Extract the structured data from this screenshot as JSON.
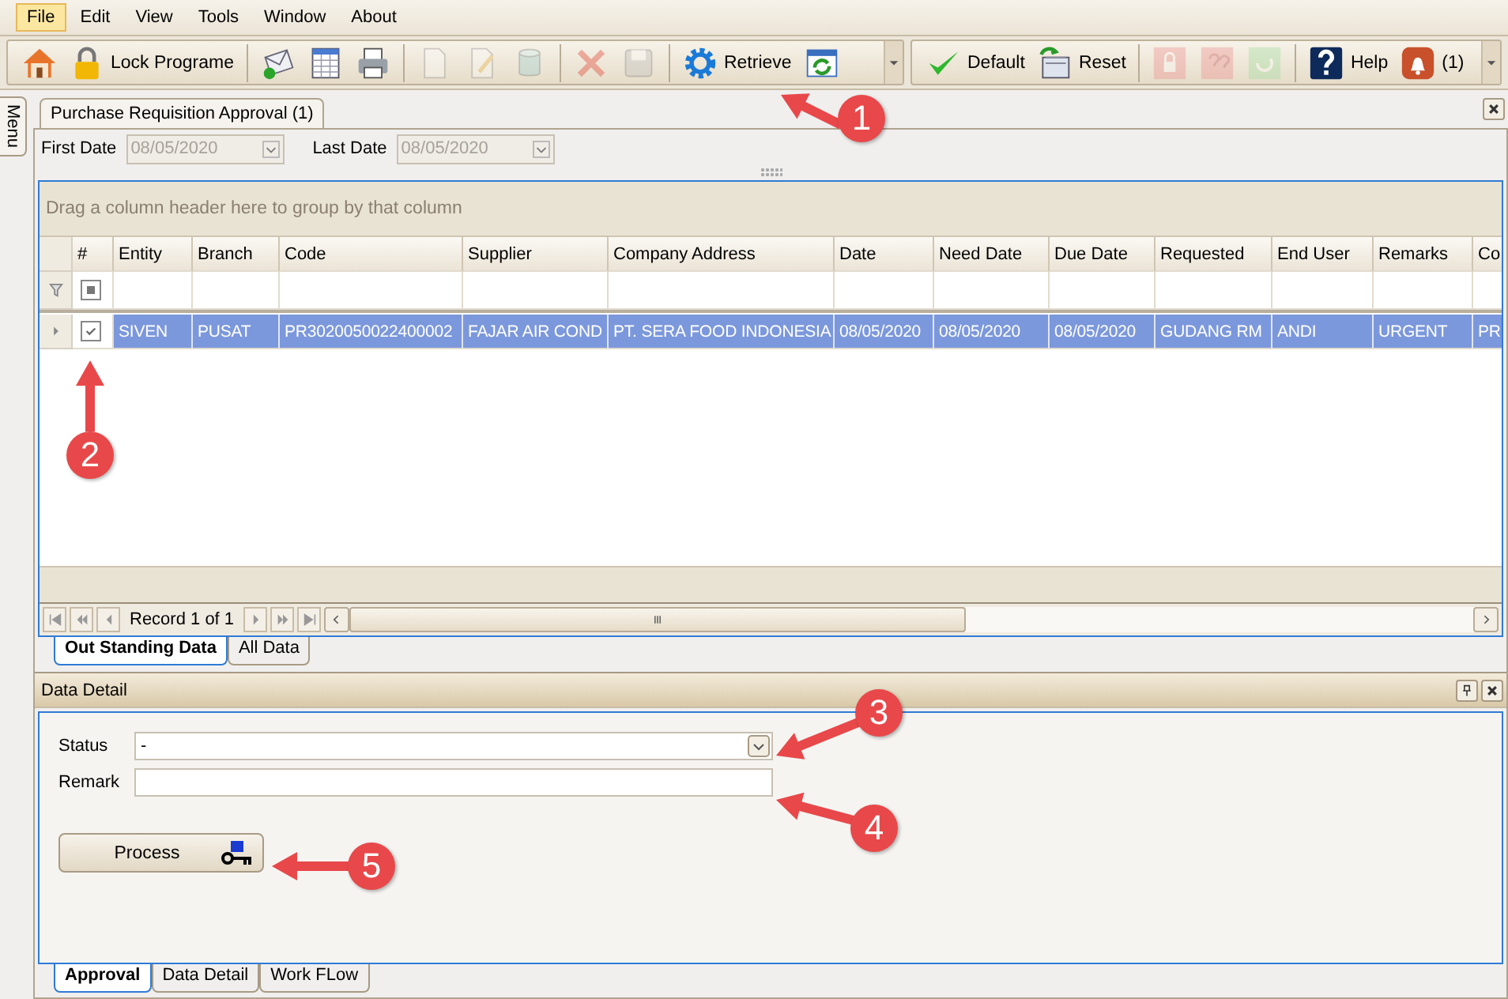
{
  "menu": [
    {
      "label": "File",
      "selected": true
    },
    {
      "label": "Edit",
      "selected": false
    },
    {
      "label": "View",
      "selected": false
    },
    {
      "label": "Tools",
      "selected": false
    },
    {
      "label": "Window",
      "selected": false
    },
    {
      "label": "About",
      "selected": false
    }
  ],
  "toolbar_left": {
    "groups": [
      [
        {
          "kind": "home",
          "disabled": false
        },
        {
          "kind": "lock",
          "label": "Lock Programe",
          "disabled": false
        }
      ],
      [
        {
          "kind": "mail",
          "disabled": false
        },
        {
          "kind": "sheet",
          "disabled": false
        },
        {
          "kind": "printer",
          "disabled": false
        }
      ],
      [
        {
          "kind": "new-doc",
          "disabled": true
        },
        {
          "kind": "edit-doc",
          "disabled": true
        },
        {
          "kind": "database",
          "disabled": true
        }
      ],
      [
        {
          "kind": "delete",
          "disabled": true
        },
        {
          "kind": "save",
          "disabled": true
        }
      ],
      [
        {
          "kind": "gear",
          "label": "Retrieve",
          "disabled": false
        },
        {
          "kind": "refresh-window",
          "disabled": false
        }
      ]
    ]
  },
  "toolbar_right": {
    "groups": [
      [
        {
          "kind": "check",
          "label": "Default",
          "disabled": false
        },
        {
          "kind": "reset",
          "label": "Reset",
          "disabled": false
        }
      ],
      [
        {
          "kind": "lock-badge",
          "disabled": true
        },
        {
          "kind": "question-badge",
          "disabled": true
        },
        {
          "kind": "cycle-badge",
          "disabled": true
        }
      ],
      [
        {
          "kind": "help",
          "label": "Help",
          "disabled": false
        },
        {
          "kind": "bell",
          "label": "(1)",
          "disabled": false
        }
      ]
    ]
  },
  "side_tab": {
    "label": "Menu"
  },
  "document_tabs": [
    {
      "label": "Purchase Requisition Approval (1)",
      "selected": true
    }
  ],
  "date_filter": [
    {
      "label": "First Date",
      "value": "08/05/2020",
      "disabled": true
    },
    {
      "label": "Last Date",
      "value": "08/05/2020",
      "disabled": true
    }
  ],
  "grid": {
    "group_hint": "Drag a column header here to group by that column",
    "check_header": "#",
    "columns": [
      "Entity",
      "Branch",
      "Code",
      "Supplier",
      "Company Address",
      "Date",
      "Need Date",
      "Due Date",
      "Requested",
      "End User",
      "Remarks",
      "Co"
    ],
    "filter_row": {
      "indeterminate": true
    },
    "rows": [
      {
        "checked": true,
        "selected": true,
        "cells": [
          "SIVEN",
          "PUSAT",
          "PR3020050022400002",
          "FAJAR AIR COND",
          "PT. SERA FOOD INDONESIA",
          "08/05/2020",
          "08/05/2020",
          "08/05/2020",
          "GUDANG RM",
          "ANDI",
          "URGENT",
          "PR"
        ]
      }
    ],
    "record_text": "Record 1 of 1"
  },
  "grid_tabs": [
    {
      "label": "Out Standing Data",
      "selected": true
    },
    {
      "label": "All Data",
      "selected": false
    }
  ],
  "detail": {
    "title": "Data Detail",
    "fields": [
      {
        "label": "Status",
        "kind": "select",
        "value": "-"
      },
      {
        "label": "Remark",
        "kind": "text"
      }
    ],
    "button": "Process",
    "tabs": [
      {
        "label": "Approval",
        "selected": true
      },
      {
        "label": "Data Detail",
        "selected": false
      },
      {
        "label": "Work FLow",
        "selected": false
      }
    ]
  },
  "callouts": [
    "1",
    "2",
    "3",
    "4",
    "5"
  ]
}
